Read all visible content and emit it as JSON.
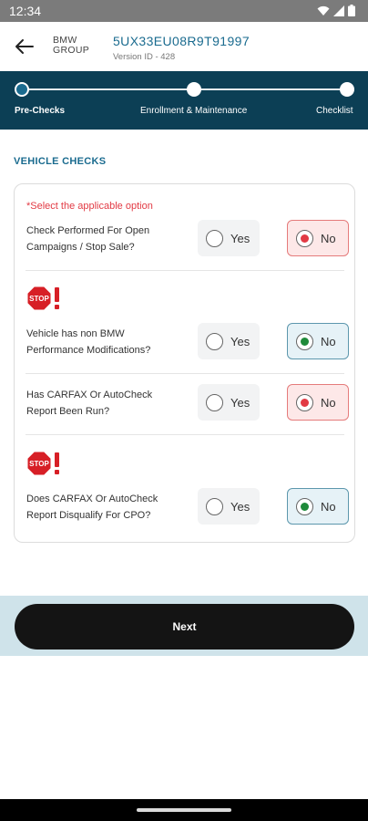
{
  "status_bar": {
    "time": "12:34"
  },
  "header": {
    "brand_line1": "BMW",
    "brand_line2": "GROUP",
    "vin": "5UX33EU08R9T91997",
    "version": "Version ID - 428"
  },
  "stepper": {
    "steps": [
      {
        "label": "Pre-Checks"
      },
      {
        "label": "Enrollment & Maintenance"
      },
      {
        "label": "Checklist"
      }
    ]
  },
  "section_title": "VEHICLE CHECKS",
  "card": {
    "instruction": "*Select the applicable option",
    "questions": [
      {
        "line1": "Check Performed For Open",
        "line2": "Campaigns / Stop Sale?",
        "yes_label": "Yes",
        "no_label": "No",
        "selected": "No"
      },
      {
        "line1": "Vehicle has non BMW",
        "line2": "Performance Modifications?",
        "yes_label": "Yes",
        "no_label": "No",
        "selected": "No"
      },
      {
        "line1": "Has CARFAX Or AutoCheck",
        "line2": "Report Been Run?",
        "yes_label": "Yes",
        "no_label": "No",
        "selected": "No"
      },
      {
        "line1": "Does CARFAX Or AutoCheck",
        "line2": "Report Disqualify For CPO?",
        "yes_label": "Yes",
        "no_label": "No",
        "selected": "No"
      }
    ],
    "stop_sign_text": "STOP"
  },
  "footer": {
    "next_label": "Next"
  },
  "colors": {
    "primary": "#0c3f55",
    "accent": "#1a6b8f",
    "danger": "#e23a44",
    "success": "#1f8a3a"
  },
  "icons": [
    "wifi-icon",
    "signal-icon",
    "battery-icon",
    "back-arrow-icon",
    "stop-sign-icon",
    "exclamation-icon"
  ]
}
